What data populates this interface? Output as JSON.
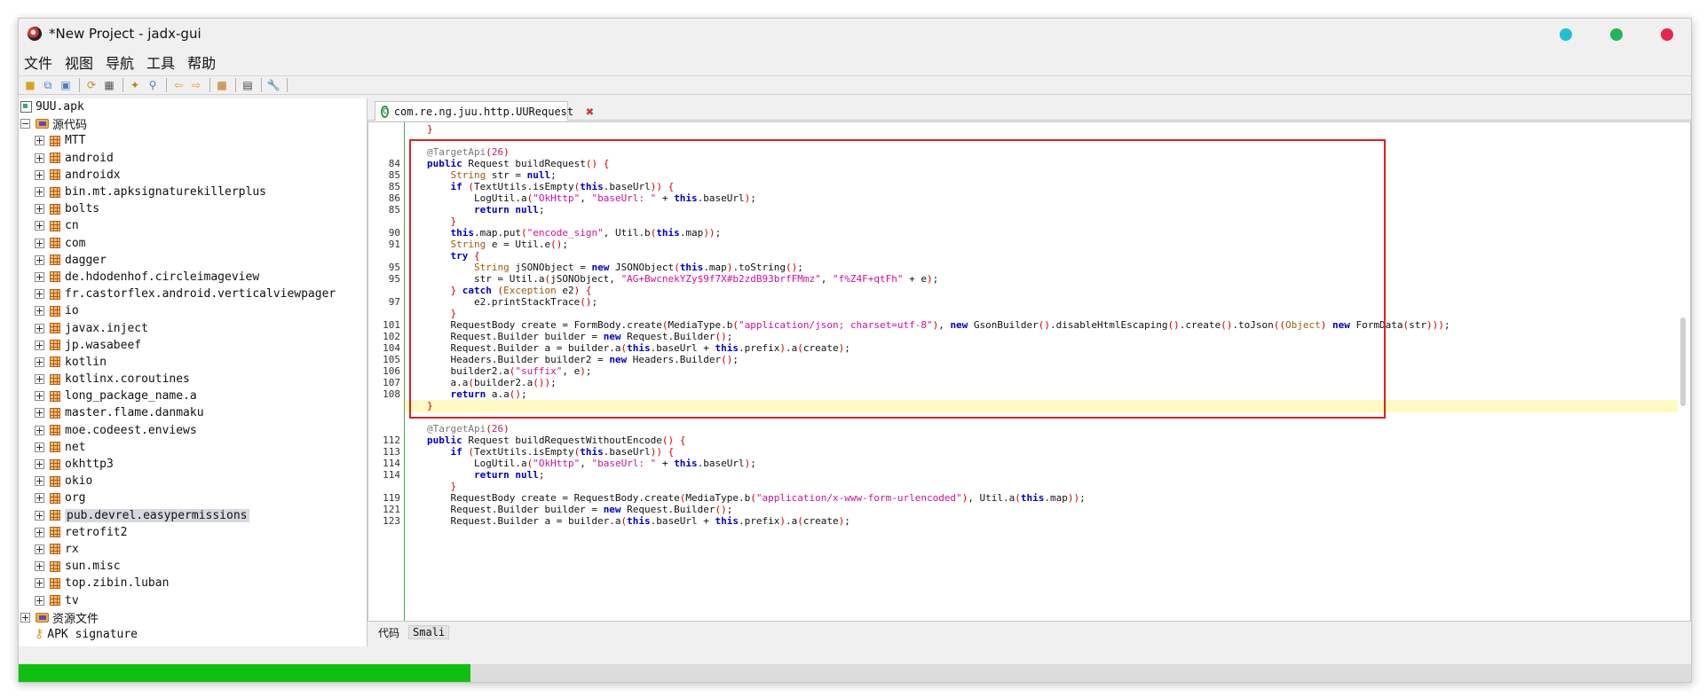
{
  "window": {
    "title": "*New Project - jadx-gui"
  },
  "menu": [
    "文件",
    "视图",
    "导航",
    "工具",
    "帮助"
  ],
  "toolbar_icons": [
    "open-file-icon",
    "add-files-icon",
    "save-all-icon",
    "sync-icon",
    "flat-packages-icon",
    "decompile-all-icon",
    "search-icon",
    "find-class-icon",
    "back-icon",
    "forward-icon",
    "deobfuscation-icon",
    "log-viewer-icon",
    "preferences-icon"
  ],
  "tree": {
    "root": "9UU.apk",
    "source_folder": "源代码",
    "packages": [
      "MTT",
      "android",
      "androidx",
      "bin.mt.apksignaturekillerplus",
      "bolts",
      "cn",
      "com",
      "dagger",
      "de.hdodenhof.circleimageview",
      "fr.castorflex.android.verticalviewpager",
      "io",
      "javax.inject",
      "jp.wasabeef",
      "kotlin",
      "kotlinx.coroutines",
      "long_package_name.a",
      "master.flame.danmaku",
      "moe.codeest.enviews",
      "net",
      "okhttp3",
      "okio",
      "org",
      "pub.devrel.easypermissions",
      "retrofit2",
      "rx",
      "sun.misc",
      "top.zibin.luban",
      "tv"
    ],
    "selected": "pub.devrel.easypermissions",
    "resources_folder": "资源文件",
    "signature": "APK signature"
  },
  "editor": {
    "tab_label": "com.re.ng.juu.http.UURequest",
    "bottom_tabs": [
      "代码",
      "Smali"
    ],
    "lines": [
      {
        "n": "",
        "html": "<span class='brace'>}</span>"
      },
      {
        "n": "",
        "html": ""
      },
      {
        "n": "",
        "html": "<span class='ann'>@TargetApi</span><span class='brace'>(</span><span class='num'>26</span><span class='brace'>)</span>"
      },
      {
        "n": "84",
        "html": "<span class='kw'>public</span> Request buildRequest<span class='brace'>()</span> <span class='brace'>{</span>"
      },
      {
        "n": "85",
        "html": "    <span class='typ'>String</span> str = <span class='kw'>null</span>;"
      },
      {
        "n": "85",
        "html": "    <span class='kw'>if</span> <span class='brace'>(</span>TextUtils.isEmpty<span class='brace'>(</span><span class='kw'>this</span>.baseUrl<span class='brace'>))</span> <span class='brace'>{</span>"
      },
      {
        "n": "86",
        "html": "        LogUtil.a<span class='brace'>(</span><span class='str'>\"OkHttp\"</span>, <span class='str'>\"baseUrl: \"</span> + <span class='kw'>this</span>.baseUrl<span class='brace'>)</span>;"
      },
      {
        "n": "85",
        "html": "        <span class='kw'>return</span> <span class='kw'>null</span>;"
      },
      {
        "n": "",
        "html": "    <span class='brace'>}</span>"
      },
      {
        "n": "90",
        "html": "    <span class='kw'>this</span>.map.put<span class='brace'>(</span><span class='str'>\"encode_sign\"</span>, Util.b<span class='brace'>(</span><span class='kw'>this</span>.map<span class='brace'>))</span>;"
      },
      {
        "n": "91",
        "html": "    <span class='typ'>String</span> e = Util.e<span class='brace'>()</span>;"
      },
      {
        "n": "",
        "html": "    <span class='kw'>try</span> <span class='brace'>{</span>"
      },
      {
        "n": "95",
        "html": "        <span class='typ'>String</span> jSONObject = <span class='kw'>new</span> JSONObject<span class='brace'>(</span><span class='kw'>this</span>.map<span class='brace'>)</span>.toString<span class='brace'>()</span>;"
      },
      {
        "n": "95",
        "html": "        str = Util.a<span class='brace'>(</span>jSONObject, <span class='str'>\"AG+BwcnekYZy$9f7X#b2zdB93brfFMmz\"</span>, <span class='str'>\"f%Z4F+qtFh\"</span> + e<span class='brace'>)</span>;"
      },
      {
        "n": "",
        "html": "    <span class='brace'>}</span> <span class='kw'>catch</span> <span class='brace'>(</span><span class='typ'>Exception</span> e2<span class='brace'>)</span> <span class='brace'>{</span>"
      },
      {
        "n": "97",
        "html": "        e2.printStackTrace<span class='brace'>()</span>;"
      },
      {
        "n": "",
        "html": "    <span class='brace'>}</span>"
      },
      {
        "n": "101",
        "html": "    RequestBody create = FormBody.create<span class='brace'>(</span>MediaType.b<span class='brace'>(</span><span class='str'>\"application/json; charset=utf-8\"</span><span class='brace'>)</span>, <span class='kw'>new</span> GsonBuilder<span class='brace'>()</span>.disableHtmlEscaping<span class='brace'>()</span>.create<span class='brace'>()</span>.toJson<span class='brace'>((</span><span class='typ'>Object</span><span class='brace'>)</span> <span class='kw'>new</span> FormData<span class='brace'>(</span>str<span class='brace'>)))</span>;"
      },
      {
        "n": "102",
        "html": "    Request.Builder builder = <span class='kw'>new</span> Request.Builder<span class='brace'>()</span>;"
      },
      {
        "n": "104",
        "html": "    Request.Builder a = builder.a<span class='brace'>(</span><span class='kw'>this</span>.baseUrl + <span class='kw'>this</span>.prefix<span class='brace'>)</span>.a<span class='brace'>(</span>create<span class='brace'>)</span>;"
      },
      {
        "n": "105",
        "html": "    Headers.Builder builder2 = <span class='kw'>new</span> Headers.Builder<span class='brace'>()</span>;"
      },
      {
        "n": "106",
        "html": "    builder2.a<span class='brace'>(</span><span class='str'>\"suffix\"</span>, e<span class='brace'>)</span>;"
      },
      {
        "n": "107",
        "html": "    a.a<span class='brace'>(</span>builder2.a<span class='brace'>())</span>;"
      },
      {
        "n": "108",
        "html": "    <span class='kw'>return</span> a.a<span class='brace'>()</span>;"
      },
      {
        "n": "",
        "html": "<span class='brace'>}</span>"
      },
      {
        "n": "",
        "html": ""
      },
      {
        "n": "",
        "html": "<span class='ann'>@TargetApi</span><span class='brace'>(</span><span class='num'>26</span><span class='brace'>)</span>"
      },
      {
        "n": "112",
        "html": "<span class='kw'>public</span> Request buildRequestWithoutEncode<span class='brace'>()</span> <span class='brace'>{</span>"
      },
      {
        "n": "113",
        "html": "    <span class='kw'>if</span> <span class='brace'>(</span>TextUtils.isEmpty<span class='brace'>(</span><span class='kw'>this</span>.baseUrl<span class='brace'>))</span> <span class='brace'>{</span>"
      },
      {
        "n": "114",
        "html": "        LogUtil.a<span class='brace'>(</span><span class='str'>\"OkHttp\"</span>, <span class='str'>\"baseUrl: \"</span> + <span class='kw'>this</span>.baseUrl<span class='brace'>)</span>;"
      },
      {
        "n": "114",
        "html": "        <span class='kw'>return</span> <span class='kw'>null</span>;"
      },
      {
        "n": "",
        "html": "    <span class='brace'>}</span>"
      },
      {
        "n": "119",
        "html": "    RequestBody create = RequestBody.create<span class='brace'>(</span>MediaType.b<span class='brace'>(</span><span class='str'>\"application/x-www-form-urlencoded\"</span><span class='brace'>)</span>, Util.a<span class='brace'>(</span><span class='kw'>this</span>.map<span class='brace'>))</span>;"
      },
      {
        "n": "121",
        "html": "    Request.Builder builder = <span class='kw'>new</span> Request.Builder<span class='brace'>()</span>;"
      },
      {
        "n": "123",
        "html": "    Request.Builder a = builder.a<span class='brace'>(</span><span class='kw'>this</span>.baseUrl + <span class='kw'>this</span>.prefix<span class='brace'>)</span>.a<span class='brace'>(</span>create<span class='brace'>)</span>;"
      }
    ]
  },
  "status": {
    "progress": 0.27
  },
  "colors": {
    "progress": "#10c010",
    "highlight_box": "#e02020"
  }
}
